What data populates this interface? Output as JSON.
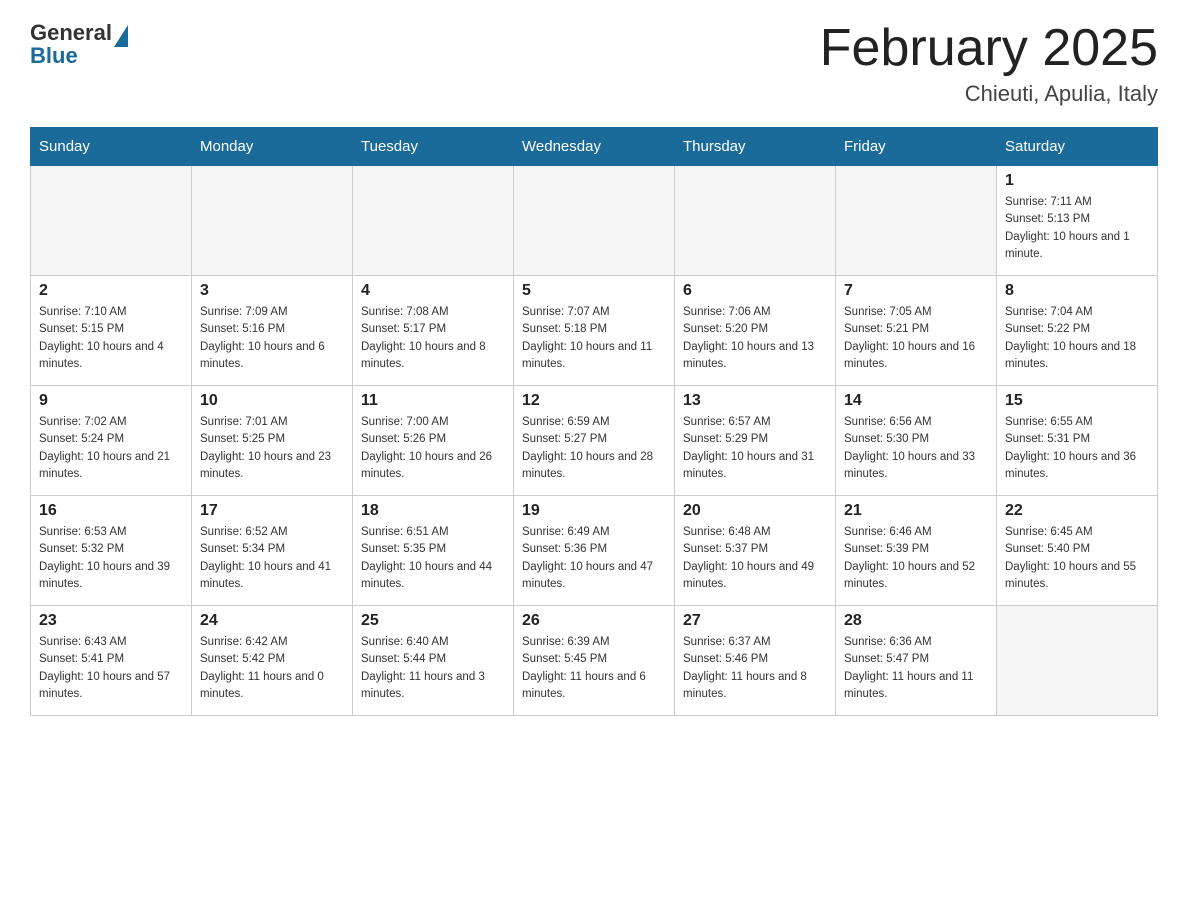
{
  "logo": {
    "general": "General",
    "blue": "Blue"
  },
  "title": "February 2025",
  "location": "Chieuti, Apulia, Italy",
  "days_of_week": [
    "Sunday",
    "Monday",
    "Tuesday",
    "Wednesday",
    "Thursday",
    "Friday",
    "Saturday"
  ],
  "weeks": [
    [
      {
        "day": "",
        "info": ""
      },
      {
        "day": "",
        "info": ""
      },
      {
        "day": "",
        "info": ""
      },
      {
        "day": "",
        "info": ""
      },
      {
        "day": "",
        "info": ""
      },
      {
        "day": "",
        "info": ""
      },
      {
        "day": "1",
        "info": "Sunrise: 7:11 AM\nSunset: 5:13 PM\nDaylight: 10 hours and 1 minute."
      }
    ],
    [
      {
        "day": "2",
        "info": "Sunrise: 7:10 AM\nSunset: 5:15 PM\nDaylight: 10 hours and 4 minutes."
      },
      {
        "day": "3",
        "info": "Sunrise: 7:09 AM\nSunset: 5:16 PM\nDaylight: 10 hours and 6 minutes."
      },
      {
        "day": "4",
        "info": "Sunrise: 7:08 AM\nSunset: 5:17 PM\nDaylight: 10 hours and 8 minutes."
      },
      {
        "day": "5",
        "info": "Sunrise: 7:07 AM\nSunset: 5:18 PM\nDaylight: 10 hours and 11 minutes."
      },
      {
        "day": "6",
        "info": "Sunrise: 7:06 AM\nSunset: 5:20 PM\nDaylight: 10 hours and 13 minutes."
      },
      {
        "day": "7",
        "info": "Sunrise: 7:05 AM\nSunset: 5:21 PM\nDaylight: 10 hours and 16 minutes."
      },
      {
        "day": "8",
        "info": "Sunrise: 7:04 AM\nSunset: 5:22 PM\nDaylight: 10 hours and 18 minutes."
      }
    ],
    [
      {
        "day": "9",
        "info": "Sunrise: 7:02 AM\nSunset: 5:24 PM\nDaylight: 10 hours and 21 minutes."
      },
      {
        "day": "10",
        "info": "Sunrise: 7:01 AM\nSunset: 5:25 PM\nDaylight: 10 hours and 23 minutes."
      },
      {
        "day": "11",
        "info": "Sunrise: 7:00 AM\nSunset: 5:26 PM\nDaylight: 10 hours and 26 minutes."
      },
      {
        "day": "12",
        "info": "Sunrise: 6:59 AM\nSunset: 5:27 PM\nDaylight: 10 hours and 28 minutes."
      },
      {
        "day": "13",
        "info": "Sunrise: 6:57 AM\nSunset: 5:29 PM\nDaylight: 10 hours and 31 minutes."
      },
      {
        "day": "14",
        "info": "Sunrise: 6:56 AM\nSunset: 5:30 PM\nDaylight: 10 hours and 33 minutes."
      },
      {
        "day": "15",
        "info": "Sunrise: 6:55 AM\nSunset: 5:31 PM\nDaylight: 10 hours and 36 minutes."
      }
    ],
    [
      {
        "day": "16",
        "info": "Sunrise: 6:53 AM\nSunset: 5:32 PM\nDaylight: 10 hours and 39 minutes."
      },
      {
        "day": "17",
        "info": "Sunrise: 6:52 AM\nSunset: 5:34 PM\nDaylight: 10 hours and 41 minutes."
      },
      {
        "day": "18",
        "info": "Sunrise: 6:51 AM\nSunset: 5:35 PM\nDaylight: 10 hours and 44 minutes."
      },
      {
        "day": "19",
        "info": "Sunrise: 6:49 AM\nSunset: 5:36 PM\nDaylight: 10 hours and 47 minutes."
      },
      {
        "day": "20",
        "info": "Sunrise: 6:48 AM\nSunset: 5:37 PM\nDaylight: 10 hours and 49 minutes."
      },
      {
        "day": "21",
        "info": "Sunrise: 6:46 AM\nSunset: 5:39 PM\nDaylight: 10 hours and 52 minutes."
      },
      {
        "day": "22",
        "info": "Sunrise: 6:45 AM\nSunset: 5:40 PM\nDaylight: 10 hours and 55 minutes."
      }
    ],
    [
      {
        "day": "23",
        "info": "Sunrise: 6:43 AM\nSunset: 5:41 PM\nDaylight: 10 hours and 57 minutes."
      },
      {
        "day": "24",
        "info": "Sunrise: 6:42 AM\nSunset: 5:42 PM\nDaylight: 11 hours and 0 minutes."
      },
      {
        "day": "25",
        "info": "Sunrise: 6:40 AM\nSunset: 5:44 PM\nDaylight: 11 hours and 3 minutes."
      },
      {
        "day": "26",
        "info": "Sunrise: 6:39 AM\nSunset: 5:45 PM\nDaylight: 11 hours and 6 minutes."
      },
      {
        "day": "27",
        "info": "Sunrise: 6:37 AM\nSunset: 5:46 PM\nDaylight: 11 hours and 8 minutes."
      },
      {
        "day": "28",
        "info": "Sunrise: 6:36 AM\nSunset: 5:47 PM\nDaylight: 11 hours and 11 minutes."
      },
      {
        "day": "",
        "info": ""
      }
    ]
  ]
}
